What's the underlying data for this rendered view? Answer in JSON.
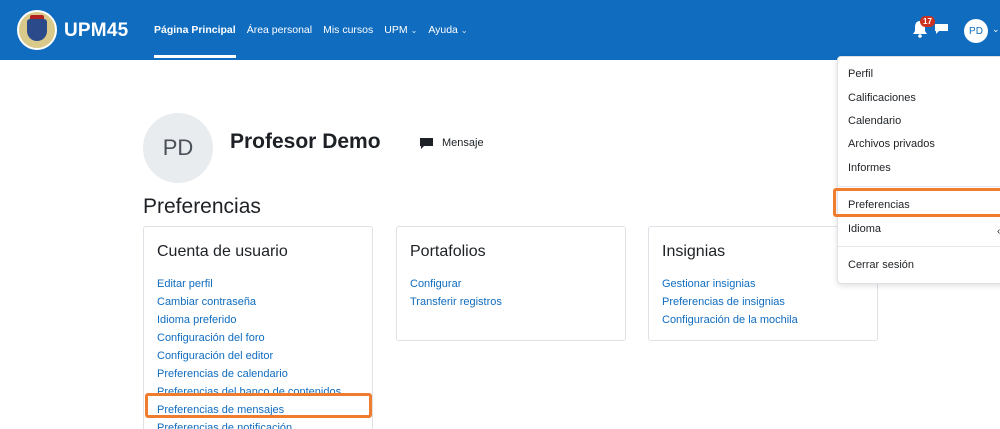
{
  "navbar": {
    "brand": "UPM45",
    "items": [
      {
        "label": "Página Principal"
      },
      {
        "label": "Área personal"
      },
      {
        "label": "Mis cursos"
      },
      {
        "label": "UPM"
      },
      {
        "label": "Ayuda"
      }
    ],
    "notification_count": "17",
    "user_initials": "PD"
  },
  "profile": {
    "initials": "PD",
    "name": "Profesor Demo",
    "message_label": "Mensaje"
  },
  "page_title": "Preferencias",
  "cards": {
    "user_account": {
      "title": "Cuenta de usuario",
      "links": [
        "Editar perfil",
        "Cambiar contraseña",
        "Idioma preferido",
        "Configuración del foro",
        "Configuración del editor",
        "Preferencias de calendario",
        "Preferencias del banco de contenidos",
        "Preferencias de mensajes",
        "Preferencias de notificación"
      ]
    },
    "portfolios": {
      "title": "Portafolios",
      "links": [
        "Configurar",
        "Transferir registros"
      ]
    },
    "badges": {
      "title": "Insignias",
      "links": [
        "Gestionar insignias",
        "Preferencias de insignias",
        "Configuración de la mochila"
      ]
    }
  },
  "user_menu": {
    "items": [
      "Perfil",
      "Calificaciones",
      "Calendario",
      "Archivos privados",
      "Informes"
    ],
    "preferences": "Preferencias",
    "language": "Idioma",
    "logout": "Cerrar sesión"
  },
  "colors": {
    "navbar": "#0f6cbf",
    "link": "#0f6cbf",
    "highlight": "#f07c2f",
    "badge": "#ca3120"
  }
}
